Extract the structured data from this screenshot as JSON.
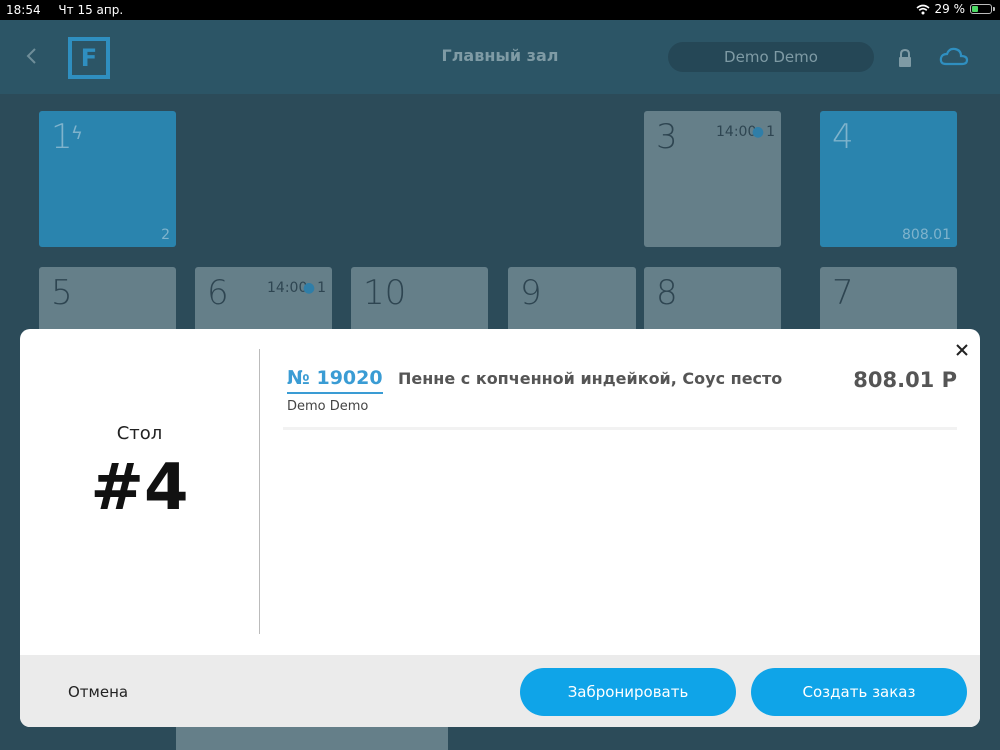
{
  "status_bar": {
    "time": "18:54",
    "date": "Чт 15 апр.",
    "battery": "29 %",
    "battery_level": 0.29
  },
  "header": {
    "title": "Главный зал",
    "user": "Demo Demo"
  },
  "tables": [
    {
      "number": "1",
      "badge_icon": "lightning-icon",
      "bottom": "2",
      "blue": true
    },
    {
      "number": "3",
      "time": "14:00",
      "guests": "1",
      "blue": false
    },
    {
      "number": "4",
      "bottom": "808.01",
      "blue": true
    },
    {
      "number": "5",
      "blue": false
    },
    {
      "number": "6",
      "time": "14:00",
      "guests": "1",
      "blue": false
    },
    {
      "number": "10",
      "blue": false
    },
    {
      "number": "9",
      "blue": false
    },
    {
      "number": "8",
      "blue": false
    },
    {
      "number": "7",
      "blue": false
    }
  ],
  "modal": {
    "table_label": "Стол",
    "table_number": "#4",
    "order": {
      "number": "№ 19020",
      "dish": "Пенне с копченной индейкой, Соус песто",
      "price": "808.01 Р",
      "waiter": "Demo Demo"
    },
    "cancel": "Отмена",
    "reserve": "Забронировать",
    "create_order": "Создать заказ"
  },
  "colors": {
    "accent": "#0fa4e8",
    "order_link": "#3a9cd4",
    "table_blue": "#2a84ae",
    "table_gray": "#657f89"
  }
}
